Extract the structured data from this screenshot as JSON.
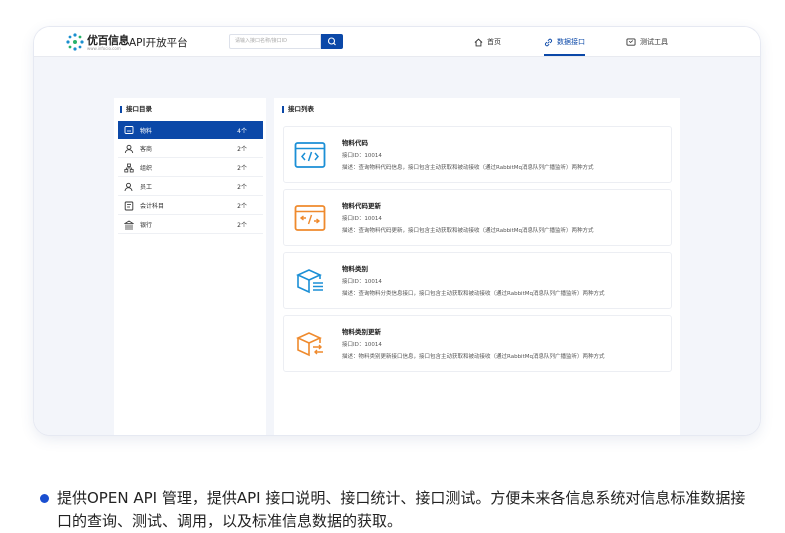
{
  "header": {
    "brand": "优百信息",
    "brand_sub": "www.infocio.com",
    "platform": "API开放平台",
    "search_placeholder": "请输入接口名称/接口ID",
    "nav": [
      {
        "label": "首页"
      },
      {
        "label": "数据接口"
      },
      {
        "label": "测试工具"
      }
    ]
  },
  "sidebar": {
    "title": "接口目录",
    "items": [
      {
        "label": "物料",
        "count": "4个"
      },
      {
        "label": "客商",
        "count": "2个"
      },
      {
        "label": "组织",
        "count": "2个"
      },
      {
        "label": "员工",
        "count": "2个"
      },
      {
        "label": "会计科目",
        "count": "2个"
      },
      {
        "label": "银行",
        "count": "2个"
      }
    ]
  },
  "main": {
    "title": "接口列表",
    "cards": [
      {
        "title": "物料代码",
        "id": "接口ID：10014",
        "desc": "描述：查询物料代码信息，接口包含主动获取和被动接收（通过RabbitMq消息队列广播监听）两种方式",
        "color": "#1b8fd6"
      },
      {
        "title": "物料代码更新",
        "id": "接口ID：10014",
        "desc": "描述：查询物料代码更新，接口包含主动获取和被动接收（通过RabbitMq消息队列广播监听）两种方式",
        "color": "#ef8a2d"
      },
      {
        "title": "物料类别",
        "id": "接口ID：10014",
        "desc": "描述：查询物料分类信息接口，接口包含主动获取和被动接收（通过RabbitMq消息队列广播监听）两种方式",
        "color": "#1b8fd6"
      },
      {
        "title": "物料类别更新",
        "id": "接口ID：10014",
        "desc": "描述：物料类别更新接口信息，接口包含主动获取和被动接收（通过RabbitMq消息队列广播监听）两种方式",
        "color": "#ef8a2d"
      }
    ]
  },
  "caption": "提供OPEN API 管理，提供API 接口说明、接口统计、接口测试。方便未来各信息系统对信息标准数据接口的查询、测试、调用，以及标准信息数据的获取。",
  "colors": {
    "accent": "#0b48a8",
    "bullet": "#1a4fd0"
  }
}
